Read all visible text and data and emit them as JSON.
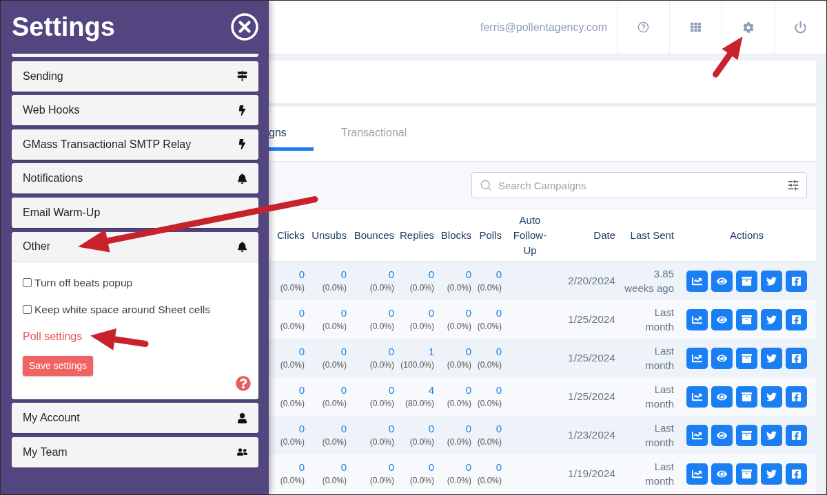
{
  "settings_panel": {
    "title": "Settings",
    "items": [
      {
        "label": "Sending",
        "expanded": false
      },
      {
        "label": "Web Hooks",
        "expanded": false
      },
      {
        "label": "GMass Transactional SMTP Relay",
        "expanded": false
      },
      {
        "label": "Notifications",
        "expanded": false
      },
      {
        "label": "Email Warm-Up",
        "expanded": false
      },
      {
        "label": "Other",
        "expanded": true,
        "options": [
          {
            "label": "Turn off beats popup",
            "checked": false
          },
          {
            "label": "Keep white space around Sheet cells",
            "checked": false
          }
        ],
        "link": "Poll settings",
        "save_button": "Save settings"
      },
      {
        "label": "My Account",
        "expanded": false
      },
      {
        "label": "My Team",
        "expanded": false
      }
    ]
  },
  "header": {
    "user_email": "ferris@pollentagency.com"
  },
  "tabs": [
    {
      "label": "gns",
      "selected": true
    },
    {
      "label": "Transactional",
      "selected": false
    }
  ],
  "search": {
    "placeholder": "Search Campaigns"
  },
  "table": {
    "columns": [
      "Clicks",
      "Unsubs",
      "Bounces",
      "Replies",
      "Blocks",
      "Polls",
      "Auto Follow-Up",
      "Date",
      "Last Sent",
      "Actions"
    ],
    "rows": [
      {
        "metrics": [
          {
            "value": "0",
            "percent": "(0.0%)"
          },
          {
            "value": "0",
            "percent": "(0.0%)"
          },
          {
            "value": "0",
            "percent": "(0.0%)"
          },
          {
            "value": "0",
            "percent": "(0.0%)"
          },
          {
            "value": "0",
            "percent": "(0.0%)"
          },
          {
            "value": "0",
            "percent": "(0.0%)"
          }
        ],
        "date": "2/20/2024",
        "last_sent": "3.85 weeks ago"
      },
      {
        "metrics": [
          {
            "value": "0",
            "percent": "(0.0%)"
          },
          {
            "value": "0",
            "percent": "(0.0%)"
          },
          {
            "value": "0",
            "percent": "(0.0%)"
          },
          {
            "value": "0",
            "percent": "(0.0%)"
          },
          {
            "value": "0",
            "percent": "(0.0%)"
          },
          {
            "value": "0",
            "percent": "(0.0%)"
          }
        ],
        "date": "1/25/2024",
        "last_sent": "Last month"
      },
      {
        "metrics": [
          {
            "value": "0",
            "percent": "(0.0%)"
          },
          {
            "value": "0",
            "percent": "(0.0%)"
          },
          {
            "value": "0",
            "percent": "(0.0%)"
          },
          {
            "value": "1",
            "percent": "(100.0%)"
          },
          {
            "value": "0",
            "percent": "(0.0%)"
          },
          {
            "value": "0",
            "percent": "(0.0%)"
          }
        ],
        "date": "1/25/2024",
        "last_sent": "Last month"
      },
      {
        "metrics": [
          {
            "value": "0",
            "percent": "(0.0%)"
          },
          {
            "value": "0",
            "percent": "(0.0%)"
          },
          {
            "value": "0",
            "percent": "(0.0%)"
          },
          {
            "value": "4",
            "percent": "(80.0%)"
          },
          {
            "value": "0",
            "percent": "(0.0%)"
          },
          {
            "value": "0",
            "percent": "(0.0%)"
          }
        ],
        "date": "1/25/2024",
        "last_sent": "Last month"
      },
      {
        "metrics": [
          {
            "value": "0",
            "percent": "(0.0%)"
          },
          {
            "value": "0",
            "percent": "(0.0%)"
          },
          {
            "value": "0",
            "percent": "(0.0%)"
          },
          {
            "value": "0",
            "percent": "(0.0%)"
          },
          {
            "value": "0",
            "percent": "(0.0%)"
          },
          {
            "value": "0",
            "percent": "(0.0%)"
          }
        ],
        "date": "1/23/2024",
        "last_sent": "Last month"
      },
      {
        "metrics": [
          {
            "value": "0",
            "percent": "(0.0%)"
          },
          {
            "value": "0",
            "percent": "(0.0%)"
          },
          {
            "value": "0",
            "percent": "(0.0%)"
          },
          {
            "value": "0",
            "percent": "(0.0%)"
          },
          {
            "value": "0",
            "percent": "(0.0%)"
          },
          {
            "value": "0",
            "percent": "(0.0%)"
          }
        ],
        "date": "1/19/2024",
        "last_sent": "Last month"
      }
    ]
  }
}
